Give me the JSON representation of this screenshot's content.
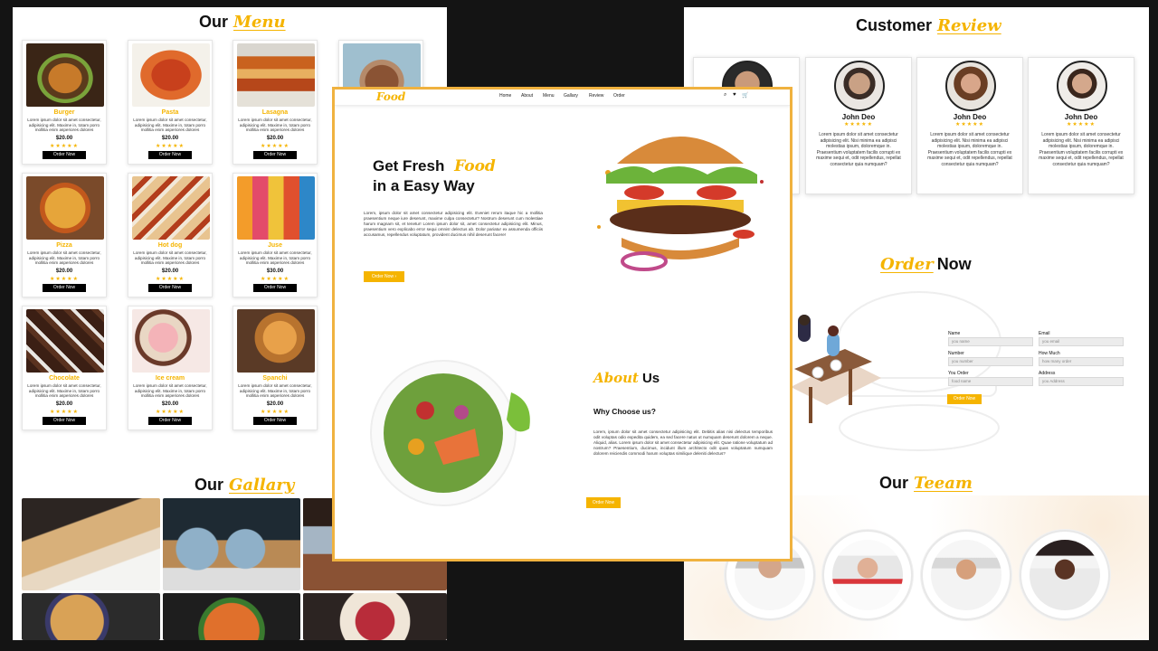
{
  "menu": {
    "title": "Our",
    "title_accent": "Menu",
    "item_description": "Lorem ipsum dolor sit amet consectetur, adipisicing elit. Maxime in, totam porro mollitia enim asperiores dolores",
    "stars": "★★★★★",
    "order_label": "Order Now",
    "items": [
      {
        "name": "Burger",
        "price": "$20.00"
      },
      {
        "name": "Pasta",
        "price": "$20.00"
      },
      {
        "name": "Lasagna",
        "price": "$20.00"
      },
      {
        "name": "",
        "price": ""
      },
      {
        "name": "Pizza",
        "price": "$20.00"
      },
      {
        "name": "Hot dog",
        "price": "$20.00"
      },
      {
        "name": "Juse",
        "price": "$30.00"
      },
      {
        "name": "Chocolate",
        "price": "$20.00"
      },
      {
        "name": "Ice cream",
        "price": "$20.00"
      },
      {
        "name": "Spanchi",
        "price": "$20.00"
      }
    ]
  },
  "gallery": {
    "title": "Our",
    "title_accent": "Gallary"
  },
  "hero": {
    "logo": "Food",
    "nav": [
      "Home",
      "About",
      "Menu",
      "Gallary",
      "Review",
      "Order"
    ],
    "heading_1": "Get Fresh",
    "heading_accent": "Food",
    "heading_2": "in a Easy Way",
    "paragraph": "Lorem, ipsum dolor sit amet consectetur adipisicing elit. Eveniet rerum itaque hic a mollitia praesentium neque iure deserunt, maxime culpa consectetur? Nostrum deserunt cum molestiae harum magnam sit, et tenetur! Lorem ipsum dolor sit, amet consectetur adipisicing elit. Minus, praesentium vero explicabo error sequi omnis! delectus ab. Dolor pariatur ex assumenda officiis accusamus, repellendus voluptatum, provident ducimus nihil deserunt facere!",
    "button": "Order Now",
    "button_icon": "arrow-right-icon",
    "icons": [
      "search-icon",
      "heart-icon",
      "cart-icon"
    ]
  },
  "about": {
    "title_accent": "About",
    "title": "Us",
    "subtitle": "Why Choose us?",
    "paragraph": "Lorem, ipsum dolor sit amet consectetur adipisicing elit. Debitis alias nisi delectus temporibus odit voluptas odio expedita quidem, ea sed facere natus ut numquam deserunt dolorem a neque. Aliquid, alias. Lorem ipsum dolor sit amet consectetur adipisicing elit. Quae ratione voluptatum ad nostrum? Praesentium, ducimus, incidunt illum architecto odit quas voluptatum numquam dolorem reiciendis commodi harum voluptas similique deleniti delectus?",
    "button": "Order Now"
  },
  "reviews": {
    "title": "Customer",
    "title_accent": "Review",
    "stars": "★★★★★",
    "items": [
      {
        "name": "",
        "text": ""
      },
      {
        "name": "John Deo",
        "text": "Lorem ipsum dolor sit amet consectetur adipisicing elit. Nisi minima ea adipisci molestias ipsum, doloremque in. Praesentium voluptatem facilis corrupti ex maxime sequi et, odit repellendus, repellat consectetur quia numquam?"
      },
      {
        "name": "John Deo",
        "text": "Lorem ipsum dolor sit amet consectetur adipisicing elit. Nisi minima ea adipisci molestias ipsum, doloremque in. Praesentium voluptatem facilis corrupti ex maxime sequi et, odit repellendus, repellat consectetur quia numquam?"
      },
      {
        "name": "John Deo",
        "text": "Lorem ipsum dolor sit amet consectetur adipisicing elit. Nisi minima ea adipisci molestias ipsum, doloremque in. Praesentium voluptatem facilis corrupti ex maxime sequi et, odit repellendus, repellat consectetur quia numquam?"
      }
    ],
    "partial_text": "Lorem ipsum dolor sit amet consectetur adipisicing elit. Nisi minima ea adipisci molestias ipsum, doloremque in. Praesentium voluptatem facilis corrupti ex maxime sequi et, odit repellendus, repellat consectetur quia numquam?"
  },
  "order": {
    "title_accent": "Order",
    "title": "Now",
    "fields": [
      {
        "label": "Name",
        "placeholder": "you name"
      },
      {
        "label": "Email",
        "placeholder": "you email"
      },
      {
        "label": "Number",
        "placeholder": "you number"
      },
      {
        "label": "How Much",
        "placeholder": "how many order"
      },
      {
        "label": "You Order",
        "placeholder": "food name"
      },
      {
        "label": "Address",
        "placeholder": "you Address"
      }
    ],
    "button": "Order Now"
  },
  "team": {
    "title": "Our",
    "title_accent": "Teeam"
  },
  "colors": {
    "accent": "#f5b400",
    "frame": "#f0b23f",
    "background": "#141414"
  }
}
